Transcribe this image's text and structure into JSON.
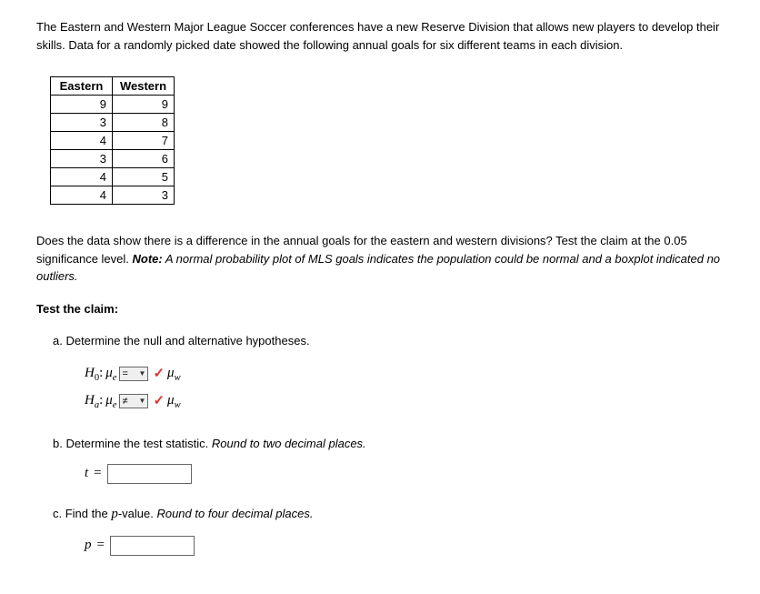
{
  "intro": "The Eastern and Western Major League Soccer conferences have a new Reserve Division that allows new players to develop their skills. Data for a randomly picked date showed the following annual goals for six different teams in each division.",
  "table": {
    "headers": [
      "Eastern",
      "Western"
    ],
    "rows": [
      [
        "9",
        "9"
      ],
      [
        "3",
        "8"
      ],
      [
        "4",
        "7"
      ],
      [
        "3",
        "6"
      ],
      [
        "4",
        "5"
      ],
      [
        "4",
        "3"
      ]
    ]
  },
  "question_text": "Does the data show there is a difference in the annual goals for the eastern and western divisions? Test the claim at the 0.05 significance level. ",
  "note_label": "Note:",
  "note_text": " A normal probability plot of MLS goals indicates the population could be normal and a boxplot indicated no outliers.",
  "test_claim_heading": "Test the claim:",
  "parts": {
    "a": {
      "prompt": "a. Determine the null and alternative hypotheses.",
      "h0_label": "H",
      "h0_sub": "0",
      "ha_label": "H",
      "ha_sub": "a",
      "mu_e_mu": "μ",
      "mu_e_sub": "e",
      "mu_w_mu": "μ",
      "mu_w_sub": "w",
      "sel_h0": "=",
      "sel_ha": "≠",
      "check": "✓"
    },
    "b": {
      "prompt": "b. Determine the test statistic. ",
      "hint": "Round to two decimal places.",
      "var": "t",
      "eq": "="
    },
    "c": {
      "prompt": "c. Find the ",
      "pvar": "p",
      "prompt2": "-value. ",
      "hint": "Round to four decimal places.",
      "var": "p",
      "eq": "="
    }
  }
}
